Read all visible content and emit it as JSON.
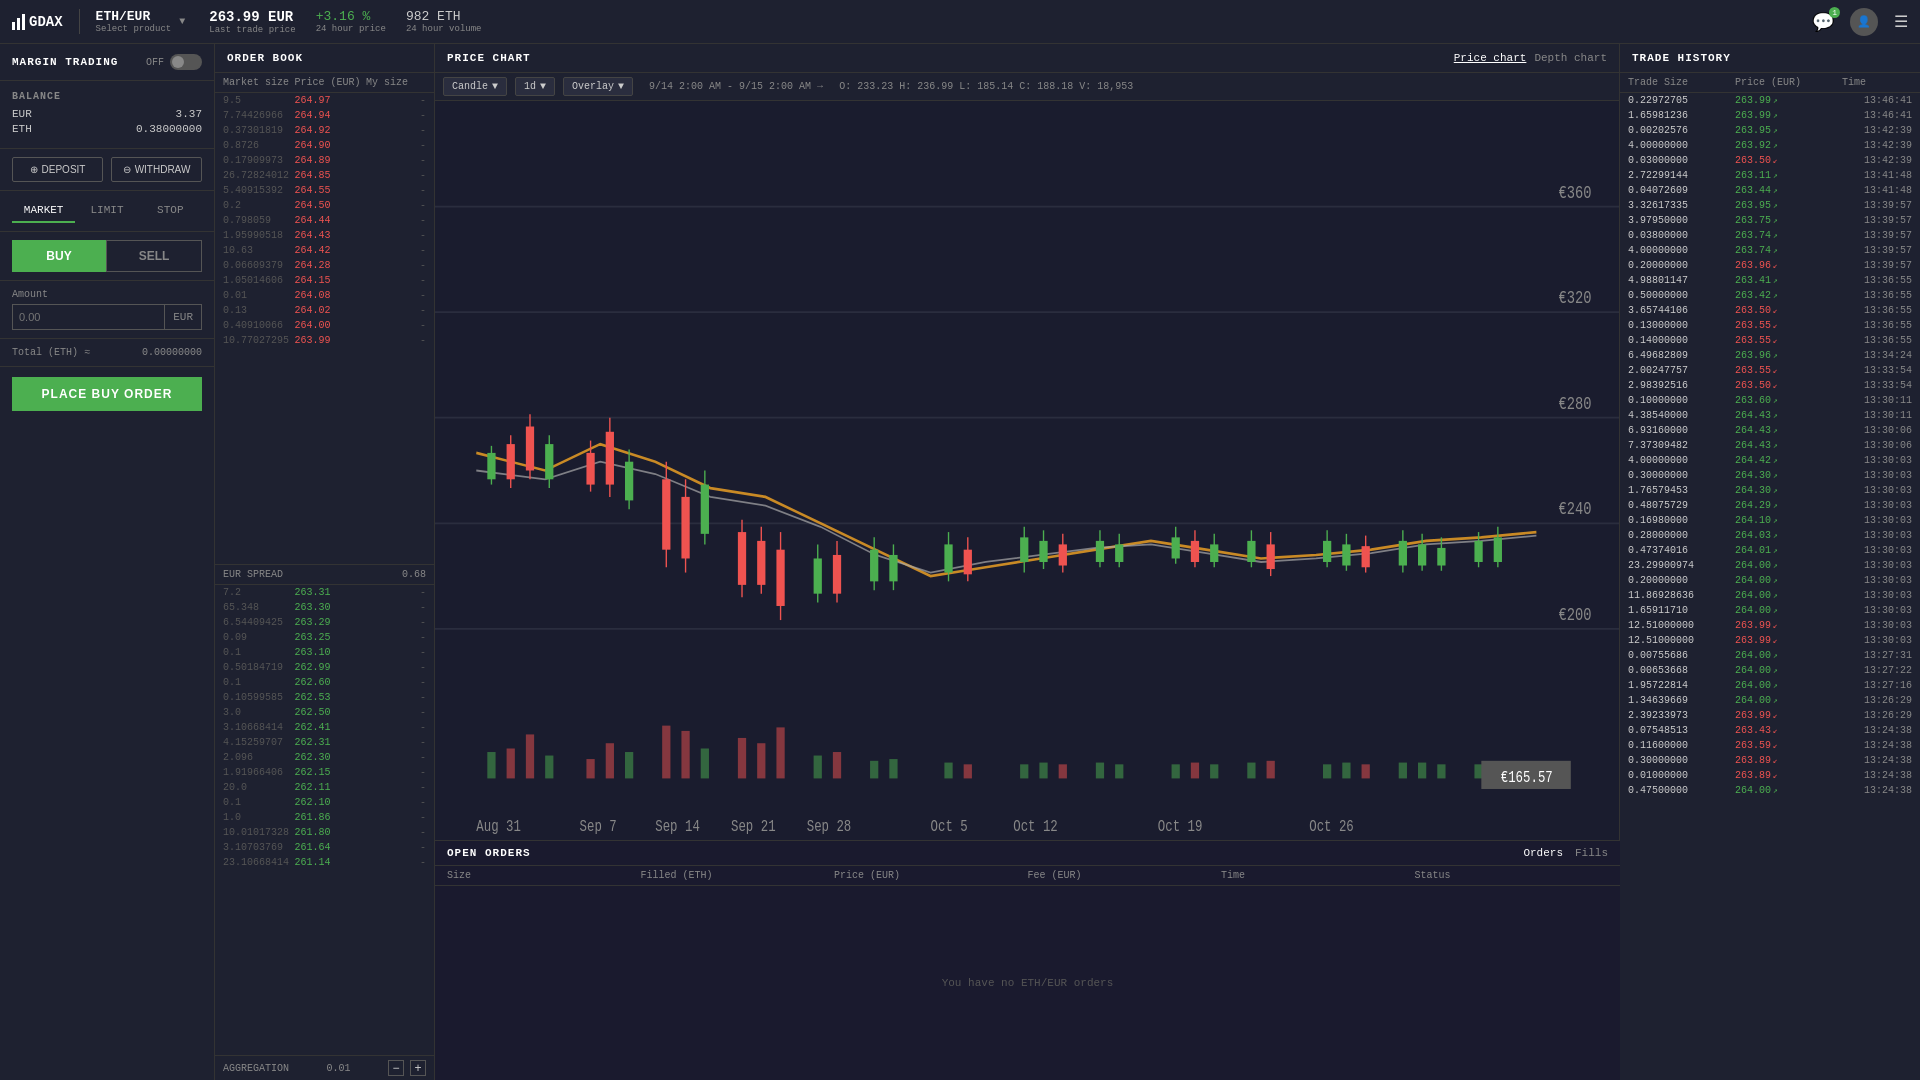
{
  "header": {
    "logo": "GDAX",
    "product": "ETH/EUR",
    "product_sub": "Select product",
    "price": "263.99 EUR",
    "price_label": "Last trade price",
    "change": "+3.16 %",
    "change_label": "24 hour price",
    "volume": "982 ETH",
    "volume_label": "24 hour volume"
  },
  "left_panel": {
    "margin_title": "MARGIN TRADING",
    "margin_toggle": "OFF",
    "balance_title": "BALANCE",
    "balance_eur": "3.37",
    "balance_eth": "0.38000000",
    "deposit_label": "DEPOSIT",
    "withdraw_label": "WITHDRAW",
    "order_tabs": [
      "MARKET",
      "LIMIT",
      "STOP"
    ],
    "active_tab": "MARKET",
    "buy_label": "BUY",
    "sell_label": "SELL",
    "amount_label": "Amount",
    "amount_placeholder": "0.00",
    "amount_unit": "EUR",
    "total_label": "Total (ETH) ≈",
    "total_value": "0.00000000",
    "place_order_label": "PLACE BUY ORDER"
  },
  "order_book": {
    "title": "ORDER BOOK",
    "col_market_size": "Market size",
    "col_price": "Price (EUR)",
    "col_my_size": "My size",
    "asks": [
      {
        "size": "9.5",
        "size2": "",
        "price": "264.97",
        "my": "-"
      },
      {
        "size": "7.74426966",
        "size2": "",
        "price": "264.94",
        "my": "-"
      },
      {
        "size": "0.37301819",
        "size2": "",
        "price": "264.92",
        "my": "-"
      },
      {
        "size": "0.8726",
        "size2": "",
        "price": "264.90",
        "my": "-"
      },
      {
        "size": "0.17909973",
        "size2": "",
        "price": "264.89",
        "my": "-"
      },
      {
        "size": "26.72824012",
        "size2": "",
        "price": "264.85",
        "my": "-"
      },
      {
        "size": "5.40915392",
        "size2": "",
        "price": "264.55",
        "my": "-"
      },
      {
        "size": "0.2",
        "size2": "",
        "price": "264.50",
        "my": "-"
      },
      {
        "size": "0.798059",
        "size2": "",
        "price": "264.44",
        "my": "-"
      },
      {
        "size": "1.95990518",
        "size2": "",
        "price": "264.43",
        "my": "-"
      },
      {
        "size": "10.63",
        "size2": "",
        "price": "264.42",
        "my": "-"
      },
      {
        "size": "0.06609379",
        "size2": "",
        "price": "264.28",
        "my": "-"
      },
      {
        "size": "1.05014606",
        "size2": "",
        "price": "264.15",
        "my": "-"
      },
      {
        "size": "0.01",
        "size2": "",
        "price": "264.08",
        "my": "-"
      },
      {
        "size": "0.13",
        "size2": "",
        "price": "264.02",
        "my": "-"
      },
      {
        "size": "0.40910066",
        "size2": "",
        "price": "264.00",
        "my": "-"
      },
      {
        "size": "10.77027295",
        "size2": "",
        "price": "263.99",
        "my": "-"
      }
    ],
    "spread_label": "EUR SPREAD",
    "spread_value": "0.68",
    "bids": [
      {
        "size": "7.2",
        "size2": "",
        "price": "263.31",
        "my": "-"
      },
      {
        "size": "65.348",
        "size2": "",
        "price": "263.30",
        "my": "-"
      },
      {
        "size": "6.54409425",
        "size2": "",
        "price": "263.29",
        "my": "-"
      },
      {
        "size": "0.09",
        "size2": "",
        "price": "263.25",
        "my": "-"
      },
      {
        "size": "0.1",
        "size2": "",
        "price": "263.10",
        "my": "-"
      },
      {
        "size": "0.50184719",
        "size2": "",
        "price": "262.99",
        "my": "-"
      },
      {
        "size": "0.1",
        "size2": "",
        "price": "262.60",
        "my": "-"
      },
      {
        "size": "0.10599585",
        "size2": "",
        "price": "262.53",
        "my": "-"
      },
      {
        "size": "3.0",
        "size2": "",
        "price": "262.50",
        "my": "-"
      },
      {
        "size": "3.10668414",
        "size2": "",
        "price": "262.41",
        "my": "-"
      },
      {
        "size": "4.15259707",
        "size2": "",
        "price": "262.31",
        "my": "-"
      },
      {
        "size": "2.096",
        "size2": "",
        "price": "262.30",
        "my": "-"
      },
      {
        "size": "1.91966406",
        "size2": "",
        "price": "262.15",
        "my": "-"
      },
      {
        "size": "20.0",
        "size2": "",
        "price": "262.11",
        "my": "-"
      },
      {
        "size": "0.1",
        "size2": "",
        "price": "262.10",
        "my": "-"
      },
      {
        "size": "1.0",
        "size2": "",
        "price": "261.86",
        "my": "-"
      },
      {
        "size": "10.01017328",
        "size2": "",
        "price": "261.80",
        "my": "-"
      },
      {
        "size": "3.10703769",
        "size2": "",
        "price": "261.64",
        "my": "-"
      },
      {
        "size": "23.10668414",
        "size2": "",
        "price": "261.14",
        "my": "-"
      }
    ],
    "aggregation_label": "AGGREGATION",
    "aggregation_value": "0.01"
  },
  "price_chart": {
    "title": "PRICE CHART",
    "view_price_chart": "Price chart",
    "view_depth_chart": "Depth chart",
    "candle_label": "Candle",
    "interval_label": "1d",
    "overlay_label": "Overlay",
    "range": "9/14 2:00 AM - 9/15 2:00 AM →",
    "ohlcv": "O: 233.23  H: 236.99  L: 185.14  C: 188.18  V: 18,953",
    "price_high": "€360",
    "price_mid1": "€320",
    "price_mid2": "€280",
    "price_mid3": "€240",
    "price_mid4": "€200",
    "price_last": "€165.57",
    "x_labels": [
      "Aug 31",
      "Sep 7",
      "Sep 14",
      "Sep 21",
      "Sep 28",
      "Oct 5",
      "Oct 12",
      "Oct 19",
      "Oct 26"
    ]
  },
  "open_orders": {
    "title": "OPEN ORDERS",
    "tabs": [
      "Orders",
      "Fills"
    ],
    "active_tab": "Orders",
    "cols": [
      "Size",
      "Filled (ETH)",
      "Price (EUR)",
      "Fee (EUR)",
      "Time",
      "Status"
    ],
    "no_orders_msg": "You have no ETH/EUR orders"
  },
  "trade_history": {
    "title": "TRADE HISTORY",
    "col_size": "Trade Size",
    "col_price": "Price (EUR)",
    "col_time": "Time",
    "trades": [
      {
        "size": "0.22972705",
        "price": "263.99",
        "dir": "up",
        "time": "13:46:41"
      },
      {
        "size": "1.65981236",
        "price": "263.99",
        "dir": "up",
        "time": "13:46:41"
      },
      {
        "size": "0.00202576",
        "price": "263.95",
        "dir": "up",
        "time": "13:42:39"
      },
      {
        "size": "4.00000000",
        "price": "263.92",
        "dir": "up",
        "time": "13:42:39"
      },
      {
        "size": "0.03000000",
        "price": "263.50",
        "dir": "down",
        "time": "13:42:39"
      },
      {
        "size": "2.72299144",
        "price": "263.11",
        "dir": "up",
        "time": "13:41:48"
      },
      {
        "size": "0.04072609",
        "price": "263.44",
        "dir": "up",
        "time": "13:41:48"
      },
      {
        "size": "3.32617335",
        "price": "263.95",
        "dir": "up",
        "time": "13:39:57"
      },
      {
        "size": "3.97950000",
        "price": "263.75",
        "dir": "up",
        "time": "13:39:57"
      },
      {
        "size": "0.03800000",
        "price": "263.74",
        "dir": "up",
        "time": "13:39:57"
      },
      {
        "size": "4.00000000",
        "price": "263.74",
        "dir": "up",
        "time": "13:39:57"
      },
      {
        "size": "0.20000000",
        "price": "263.96",
        "dir": "down",
        "time": "13:39:57"
      },
      {
        "size": "4.98801147",
        "price": "263.41",
        "dir": "up",
        "time": "13:36:55"
      },
      {
        "size": "0.50000000",
        "price": "263.42",
        "dir": "up",
        "time": "13:36:55"
      },
      {
        "size": "3.65744106",
        "price": "263.50",
        "dir": "down",
        "time": "13:36:55"
      },
      {
        "size": "0.13000000",
        "price": "263.55",
        "dir": "down",
        "time": "13:36:55"
      },
      {
        "size": "0.14000000",
        "price": "263.55",
        "dir": "down",
        "time": "13:36:55"
      },
      {
        "size": "6.49682809",
        "price": "263.96",
        "dir": "up",
        "time": "13:34:24"
      },
      {
        "size": "2.00247757",
        "price": "263.55",
        "dir": "down",
        "time": "13:33:54"
      },
      {
        "size": "2.98392516",
        "price": "263.50",
        "dir": "down",
        "time": "13:33:54"
      },
      {
        "size": "0.10000000",
        "price": "263.60",
        "dir": "up",
        "time": "13:30:11"
      },
      {
        "size": "4.38540000",
        "price": "264.43",
        "dir": "up",
        "time": "13:30:11"
      },
      {
        "size": "6.93160000",
        "price": "264.43",
        "dir": "up",
        "time": "13:30:06"
      },
      {
        "size": "7.37309482",
        "price": "264.43",
        "dir": "up",
        "time": "13:30:06"
      },
      {
        "size": "4.00000000",
        "price": "264.42",
        "dir": "up",
        "time": "13:30:03"
      },
      {
        "size": "0.30000000",
        "price": "264.30",
        "dir": "up",
        "time": "13:30:03"
      },
      {
        "size": "1.76579453",
        "price": "264.30",
        "dir": "up",
        "time": "13:30:03"
      },
      {
        "size": "0.48075729",
        "price": "264.29",
        "dir": "up",
        "time": "13:30:03"
      },
      {
        "size": "0.16980000",
        "price": "264.10",
        "dir": "up",
        "time": "13:30:03"
      },
      {
        "size": "0.28000000",
        "price": "264.03",
        "dir": "up",
        "time": "13:30:03"
      },
      {
        "size": "0.47374016",
        "price": "264.01",
        "dir": "up",
        "time": "13:30:03"
      },
      {
        "size": "23.29900974",
        "price": "264.00",
        "dir": "up",
        "time": "13:30:03"
      },
      {
        "size": "0.20000000",
        "price": "264.00",
        "dir": "up",
        "time": "13:30:03"
      },
      {
        "size": "11.86928636",
        "price": "264.00",
        "dir": "up",
        "time": "13:30:03"
      },
      {
        "size": "1.65911710",
        "price": "264.00",
        "dir": "up",
        "time": "13:30:03"
      },
      {
        "size": "12.51000000",
        "price": "263.99",
        "dir": "down",
        "time": "13:30:03"
      },
      {
        "size": "12.51000000",
        "price": "263.99",
        "dir": "down",
        "time": "13:30:03"
      },
      {
        "size": "0.00755686",
        "price": "264.00",
        "dir": "up",
        "time": "13:27:31"
      },
      {
        "size": "0.00653668",
        "price": "264.00",
        "dir": "up",
        "time": "13:27:22"
      },
      {
        "size": "1.95722814",
        "price": "264.00",
        "dir": "up",
        "time": "13:27:16"
      },
      {
        "size": "1.34639669",
        "price": "264.00",
        "dir": "up",
        "time": "13:26:29"
      },
      {
        "size": "2.39233973",
        "price": "263.99",
        "dir": "down",
        "time": "13:26:29"
      },
      {
        "size": "0.07548513",
        "price": "263.43",
        "dir": "down",
        "time": "13:24:38"
      },
      {
        "size": "0.11600000",
        "price": "263.59",
        "dir": "down",
        "time": "13:24:38"
      },
      {
        "size": "0.30000000",
        "price": "263.89",
        "dir": "down",
        "time": "13:24:38"
      },
      {
        "size": "0.01000000",
        "price": "263.89",
        "dir": "down",
        "time": "13:24:38"
      },
      {
        "size": "0.47500000",
        "price": "264.00",
        "dir": "up",
        "time": "13:24:38"
      }
    ]
  }
}
